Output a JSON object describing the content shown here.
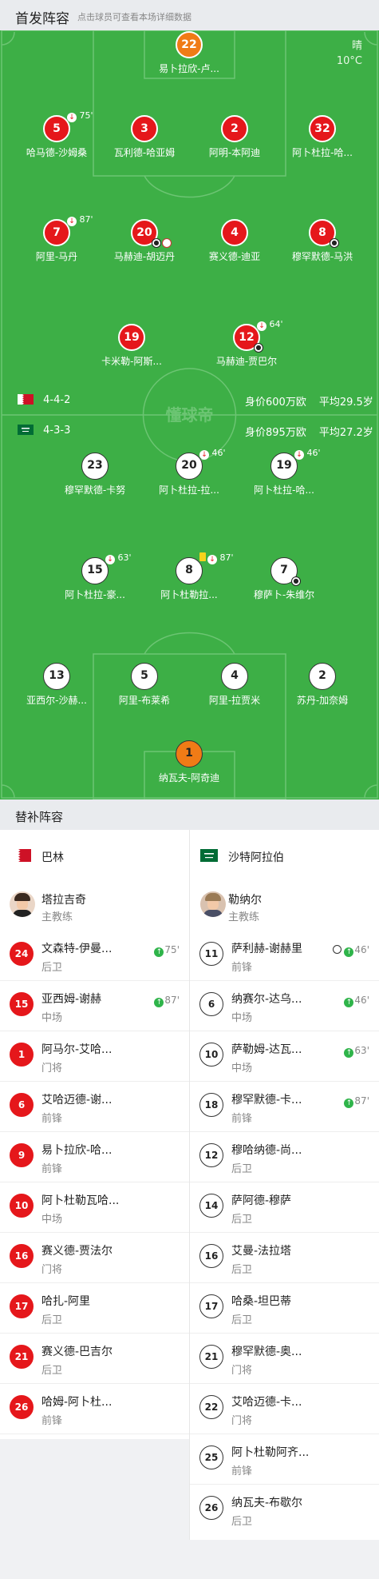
{
  "header": {
    "title": "首发阵容",
    "hint": "点击球员可查看本场详细数据"
  },
  "weather": {
    "condition": "晴",
    "temperature": "10°C"
  },
  "watermark": "懂球帝",
  "home_team": {
    "name": "巴林",
    "formation": "4-4-2",
    "value_label": "身价600万欧",
    "avg_age_label": "平均29.5岁",
    "flag_colors": [
      "#ffffff",
      "#ce1126"
    ]
  },
  "away_team": {
    "name": "沙特阿拉伯",
    "formation": "4-3-3",
    "value_label": "身价895万欧",
    "avg_age_label": "平均27.2岁",
    "flag_colors": [
      "#006c35",
      "#ffffff"
    ]
  },
  "home_starters": [
    {
      "number": "22",
      "name": "易卜拉欣-卢...",
      "keeper": true
    },
    {
      "number": "5",
      "name": "哈马德-沙姆桑",
      "sub_minute": "75'"
    },
    {
      "number": "3",
      "name": "瓦利德-哈亚姆"
    },
    {
      "number": "2",
      "name": "阿明-本阿迪"
    },
    {
      "number": "32",
      "name": "阿卜杜拉-哈..."
    },
    {
      "number": "7",
      "name": "阿里-马丹",
      "sub_minute": "87'"
    },
    {
      "number": "20",
      "name": "马赫迪-胡迈丹"
    },
    {
      "number": "4",
      "name": "赛义德-迪亚"
    },
    {
      "number": "8",
      "name": "穆罕默德-马洪"
    },
    {
      "number": "19",
      "name": "卡米勒-阿斯..."
    },
    {
      "number": "12",
      "name": "马赫迪-贾巴尔",
      "sub_minute": "64'"
    }
  ],
  "away_starters": [
    {
      "number": "23",
      "name": "穆罕默德-卡努"
    },
    {
      "number": "20",
      "name": "阿卜杜拉-拉...",
      "sub_minute": "46'"
    },
    {
      "number": "19",
      "name": "阿卜杜拉-哈...",
      "sub_minute": "46'"
    },
    {
      "number": "15",
      "name": "阿卜杜拉-豪...",
      "sub_minute": "63'"
    },
    {
      "number": "8",
      "name": "阿卜杜勒拉...",
      "sub_minute": "87'"
    },
    {
      "number": "7",
      "name": "穆萨卜-朱维尔"
    },
    {
      "number": "13",
      "name": "亚西尔-沙赫..."
    },
    {
      "number": "5",
      "name": "阿里-布莱希"
    },
    {
      "number": "4",
      "name": "阿里-拉贾米"
    },
    {
      "number": "2",
      "name": "苏丹-加奈姆"
    },
    {
      "number": "1",
      "name": "纳瓦夫-阿奇迪",
      "keeper": true
    }
  ],
  "subs_header": "替补阵容",
  "home_bench": {
    "coach": {
      "name": "塔拉吉奇",
      "role": "主教练"
    },
    "players": [
      {
        "number": "24",
        "name": "文森特-伊曼...",
        "position": "后卫",
        "sub_in": "75'"
      },
      {
        "number": "15",
        "name": "亚西姆-谢赫",
        "position": "中场",
        "sub_in": "87'"
      },
      {
        "number": "1",
        "name": "阿马尔-艾哈...",
        "position": "门将"
      },
      {
        "number": "6",
        "name": "艾哈迈德-谢...",
        "position": "前锋"
      },
      {
        "number": "9",
        "name": "易卜拉欣-哈...",
        "position": "前锋"
      },
      {
        "number": "10",
        "name": "阿卜杜勒瓦哈...",
        "position": "中场"
      },
      {
        "number": "16",
        "name": "赛义德-贾法尔",
        "position": "门将"
      },
      {
        "number": "17",
        "name": "哈扎-阿里",
        "position": "后卫"
      },
      {
        "number": "21",
        "name": "赛义德-巴吉尔",
        "position": "后卫"
      },
      {
        "number": "26",
        "name": "哈姆-阿卜杜...",
        "position": "前锋"
      }
    ]
  },
  "away_bench": {
    "coach": {
      "name": "勒纳尔",
      "role": "主教练"
    },
    "players": [
      {
        "number": "11",
        "name": "萨利赫-谢赫里",
        "position": "前锋",
        "sub_in": "46'",
        "goal": true
      },
      {
        "number": "6",
        "name": "纳赛尔-达乌...",
        "position": "中场",
        "sub_in": "46'"
      },
      {
        "number": "10",
        "name": "萨勒姆-达瓦...",
        "position": "中场",
        "sub_in": "63'"
      },
      {
        "number": "18",
        "name": "穆罕默德-卡...",
        "position": "前锋",
        "sub_in": "87'"
      },
      {
        "number": "12",
        "name": "穆哈纳德-尚...",
        "position": "后卫"
      },
      {
        "number": "14",
        "name": "萨阿德-穆萨",
        "position": "后卫"
      },
      {
        "number": "16",
        "name": "艾曼-法拉塔",
        "position": "后卫"
      },
      {
        "number": "17",
        "name": "哈桑-坦巴蒂",
        "position": "后卫"
      },
      {
        "number": "21",
        "name": "穆罕默德-奥...",
        "position": "门将"
      },
      {
        "number": "22",
        "name": "艾哈迈德-卡...",
        "position": "门将"
      },
      {
        "number": "25",
        "name": "阿卜杜勒阿齐...",
        "position": "前锋"
      },
      {
        "number": "26",
        "name": "纳瓦夫-布歇尔",
        "position": "后卫"
      }
    ]
  }
}
